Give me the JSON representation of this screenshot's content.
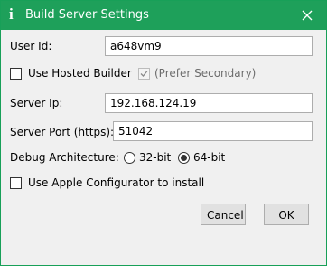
{
  "window": {
    "title": "Build Server Settings",
    "icon": "info-i-icon",
    "accent_color": "#1ea05a"
  },
  "form": {
    "user_id_label": "User Id:",
    "user_id_value": "a648vm9",
    "use_hosted_builder_label": "Use Hosted Builder",
    "use_hosted_builder_checked": false,
    "prefer_secondary_label": "(Prefer Secondary)",
    "prefer_secondary_checked": true,
    "prefer_secondary_enabled": false,
    "server_ip_label": "Server Ip:",
    "server_ip_value": "192.168.124.19",
    "server_port_label": "Server Port (https):",
    "server_port_value": "51042",
    "debug_arch_label": "Debug Architecture:",
    "arch_options": [
      "32-bit",
      "64-bit"
    ],
    "arch_selected": "64-bit",
    "apple_configurator_label": "Use Apple Configurator to install",
    "apple_configurator_checked": false
  },
  "buttons": {
    "cancel_label": "Cancel",
    "ok_label": "OK"
  }
}
